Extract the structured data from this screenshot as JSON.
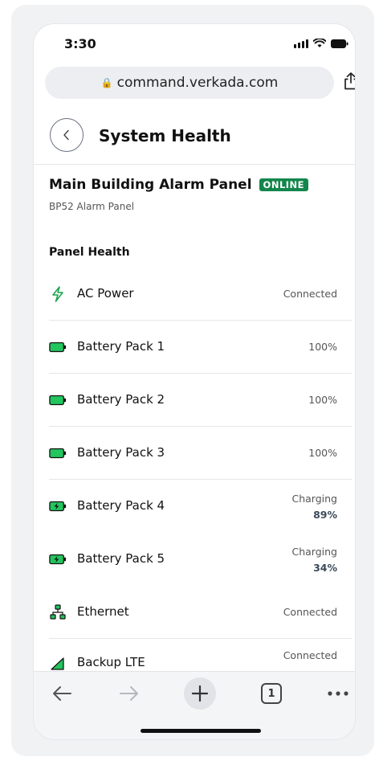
{
  "status_bar": {
    "time": "3:30"
  },
  "browser": {
    "url": "command.verkada.com"
  },
  "header": {
    "title": "System Health"
  },
  "device": {
    "name": "Main Building Alarm Panel",
    "status": "ONLINE",
    "model": "BP52 Alarm Panel"
  },
  "section": {
    "title": "Panel Health"
  },
  "rows": [
    {
      "label": "AC Power",
      "status": "Connected",
      "icon": "lightning-icon"
    },
    {
      "label": "Battery Pack 1",
      "status": "100%",
      "icon": "battery-full-icon",
      "level": 1.0
    },
    {
      "label": "Battery Pack 2",
      "status": "100%",
      "icon": "battery-full-icon",
      "level": 1.0
    },
    {
      "label": "Battery Pack 3",
      "status": "100%",
      "icon": "battery-full-icon",
      "level": 1.0
    },
    {
      "label": "Battery Pack 4",
      "status": "Charging",
      "value": "89%",
      "icon": "battery-charging-icon"
    },
    {
      "label": "Battery Pack 5",
      "status": "Charging",
      "value": "34%",
      "icon": "battery-charging-icon"
    },
    {
      "label": "Ethernet",
      "status": "Connected",
      "icon": "network-icon"
    },
    {
      "label": "Backup LTE",
      "status": "Connected",
      "icon": "cellular-icon"
    }
  ],
  "toolbar": {
    "tab_count": "1"
  },
  "colors": {
    "accent_green": "#13864d",
    "icon_green": "#22c55e"
  }
}
